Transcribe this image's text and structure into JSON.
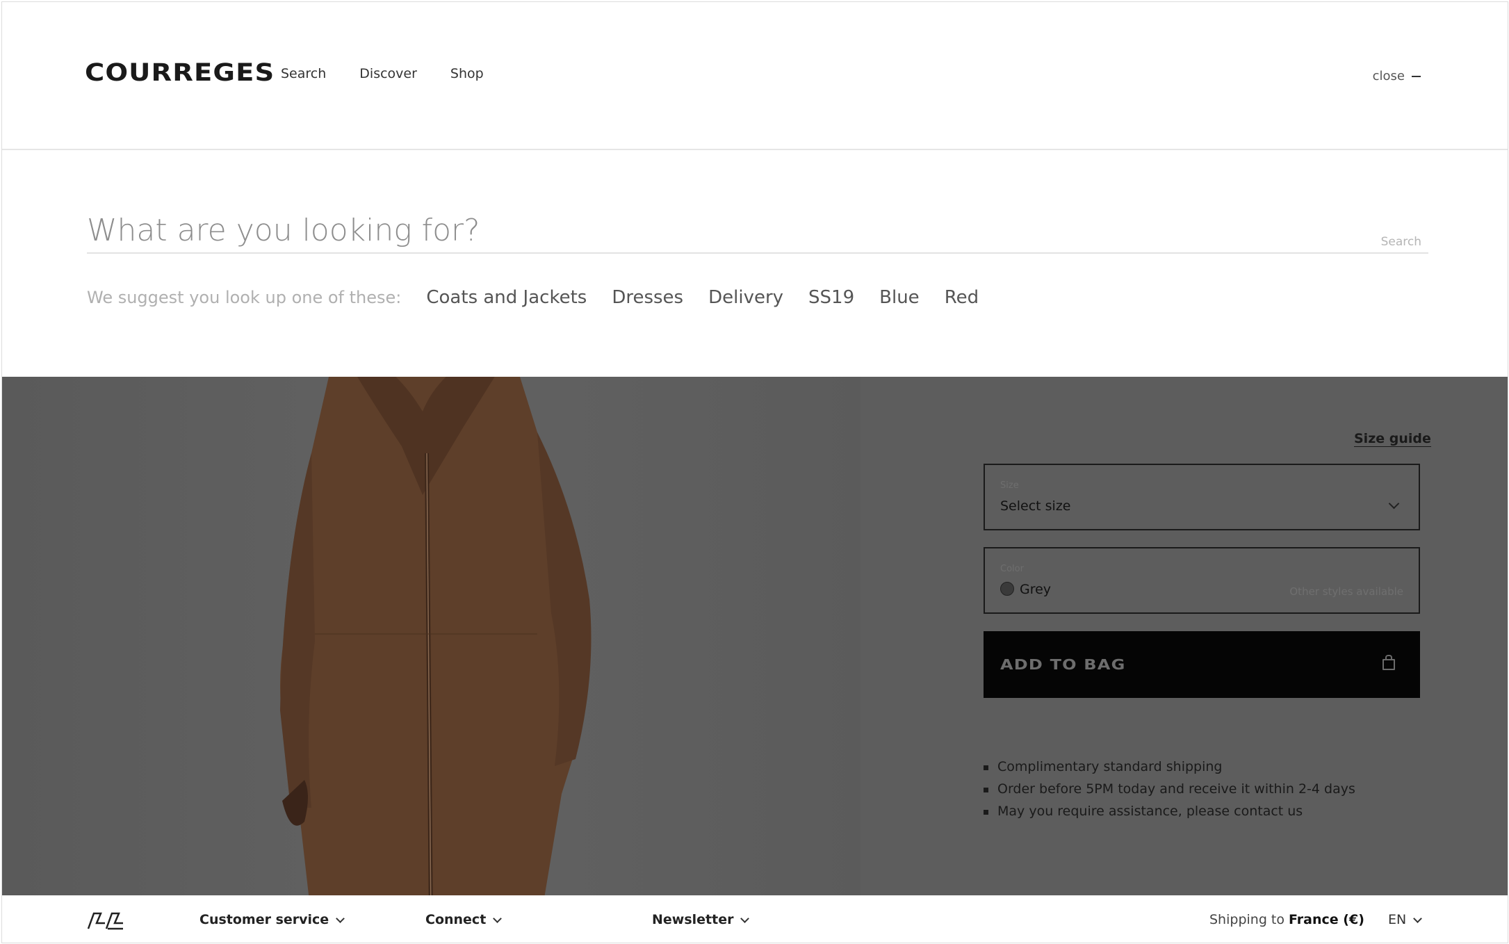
{
  "header": {
    "logo": "COURREGES",
    "nav": [
      "Search",
      "Discover",
      "Shop"
    ],
    "close_label": "close"
  },
  "search": {
    "placeholder": "What are you looking for?",
    "button_label": "Search",
    "suggest_label": "We suggest you look up one of these:",
    "suggestions": [
      "Coats and Jackets",
      "Dresses",
      "Delivery",
      "SS19",
      "Blue",
      "Red"
    ]
  },
  "product": {
    "size_guide": "Size guide",
    "size_caption": "Size",
    "size_value": "Select size",
    "color_caption": "Color",
    "color_value": "Grey",
    "other_styles": "Other styles available",
    "add_to_bag": "ADD TO BAG",
    "perks": [
      "Complimentary standard shipping",
      "Order before 5PM today and receive it within 2-4 days",
      "May you require assistance, please contact us"
    ]
  },
  "footer": {
    "customer_service": "Customer service",
    "connect": "Connect",
    "newsletter": "Newsletter",
    "shipping_prefix": "Shipping to",
    "shipping_country": "France (€)",
    "language": "EN"
  },
  "colors": {
    "overlay": "#5d5d5d",
    "button_bg": "#050505",
    "coat": "#5e3f2a"
  }
}
